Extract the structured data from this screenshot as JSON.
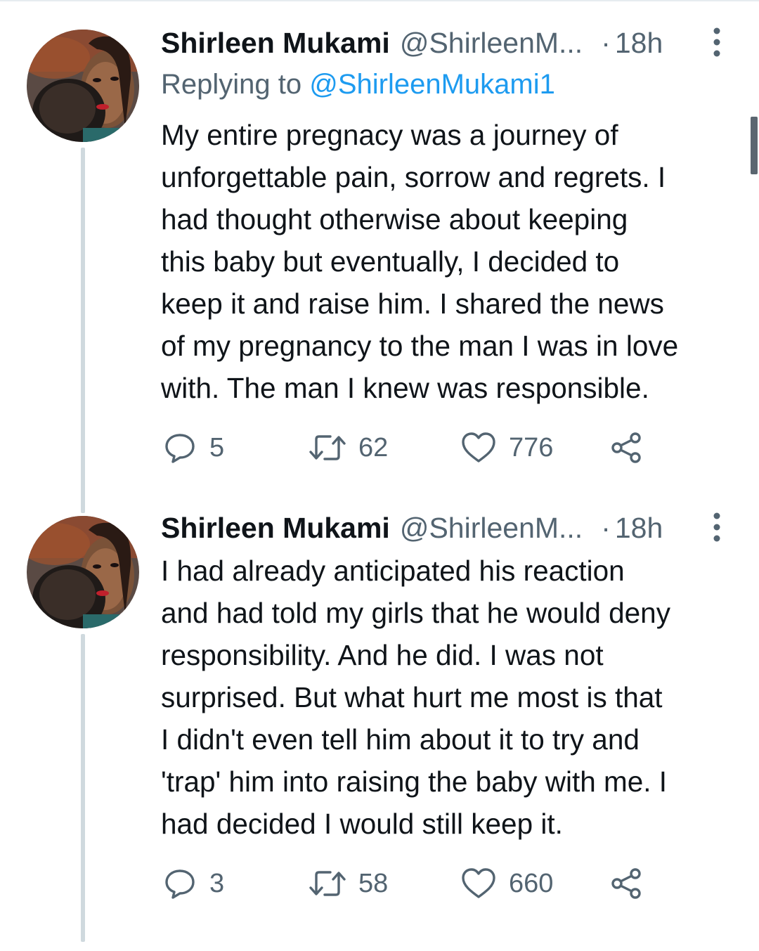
{
  "tweets": [
    {
      "author_name": "Shirleen Mukami",
      "author_handle": "@ShirleenM...",
      "separator": "·",
      "time": "18h",
      "reply_prefix": "Replying to ",
      "reply_mention": "@ShirleenMukami1",
      "text_lines": [
        "My entire pregnacy was a journey of",
        "unforgettable pain, sorrow and regrets. I",
        "had thought otherwise about keeping",
        "this baby but eventually, I decided to",
        "keep it and raise him. I shared the news",
        "of my pregnancy to the man I was in love",
        "with. The man I knew was responsible."
      ],
      "replies": "5",
      "retweets": "62",
      "likes": "776"
    },
    {
      "author_name": "Shirleen Mukami",
      "author_handle": "@ShirleenM...",
      "separator": "·",
      "time": "18h",
      "text_lines": [
        "I had already anticipated his reaction",
        "and had told my girls that he would deny",
        "responsibility. And he did. I was not",
        "surprised. But what hurt me most is that",
        "I didn't even tell him about it to try and",
        "'trap' him into raising the baby with me. I",
        "had decided I would still keep it."
      ],
      "replies": "3",
      "retweets": "58",
      "likes": "660"
    }
  ],
  "icons": {
    "more": "more-vertical-icon",
    "reply": "reply-icon",
    "retweet": "retweet-icon",
    "like": "heart-icon",
    "share": "share-icon"
  },
  "colors": {
    "text": "#0f1419",
    "secondary": "#536471",
    "link": "#1d9bf0",
    "thread_line": "#cfd9de"
  }
}
